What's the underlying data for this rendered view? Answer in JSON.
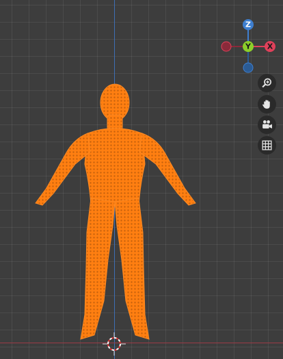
{
  "viewport": {
    "mesh_color": "#ff7f11",
    "mesh_edge_color": "#b85a0a",
    "grid_color": "#3d3d3d"
  },
  "axes": {
    "x_axis_color": "#9c3a45",
    "y_axis_color": "#3f6fb5"
  },
  "gizmo": {
    "z_label": "Z",
    "y_label": "Y",
    "x_label": "X",
    "x_color": "#e0405a",
    "y_color": "#8cce2a",
    "z_color": "#3e7fd0",
    "neg_x_color": "#8a2a3a",
    "neg_z_color": "#2b5b94"
  },
  "toolbar": {
    "tools": [
      {
        "icon": "zoom-icon"
      },
      {
        "icon": "hand-icon"
      },
      {
        "icon": "camera-icon"
      },
      {
        "icon": "grid-icon"
      }
    ]
  }
}
